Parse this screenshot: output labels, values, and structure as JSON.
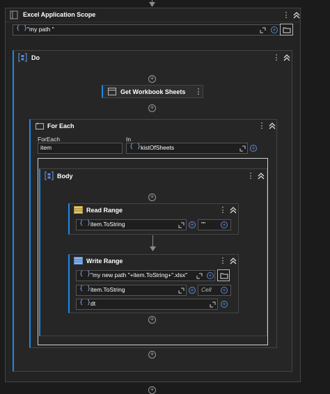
{
  "scope": {
    "title": "Excel Application Scope",
    "path_value": "\"my path \""
  },
  "do_seq": {
    "title": "Do"
  },
  "get_sheets": {
    "title": "Get Workbook Sheets"
  },
  "foreach": {
    "title": "For Each",
    "foreach_label": "ForEach",
    "in_label": "In",
    "item_value": "item",
    "in_value": "kistOfSheets"
  },
  "body": {
    "title": "Body"
  },
  "read_range": {
    "title": "Read Range",
    "field_value": "item.ToString",
    "range_value": "\"\""
  },
  "write_range": {
    "title": "Write Range",
    "path_value": "\"my new path \"+item.ToString+\".xlsx\"",
    "sheet_value": "item.ToString",
    "cell_placeholder": "Cell",
    "data_value": "dt"
  },
  "icons": {
    "more": "⋮",
    "brace": "{ }",
    "plus": "+"
  },
  "colors": {
    "accent": "#1e88e5",
    "background": "#1b1b1b",
    "card": "#262626"
  }
}
